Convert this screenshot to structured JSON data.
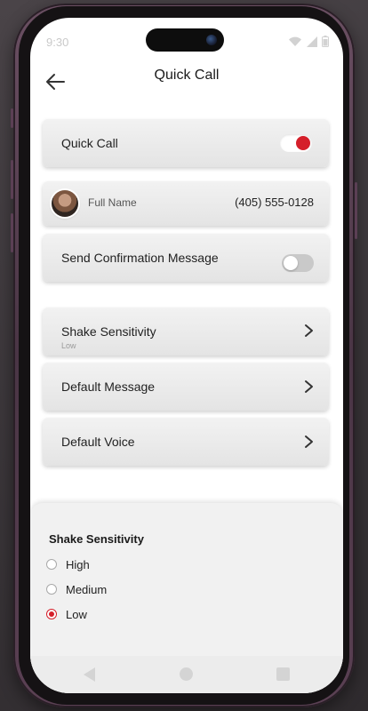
{
  "status_bar": {
    "time": "9:30"
  },
  "header": {
    "title": "Quick Call"
  },
  "quick_call": {
    "label": "Quick Call",
    "enabled": true
  },
  "contact": {
    "name": "Full Name",
    "phone": "(405) 555-0128"
  },
  "confirmation": {
    "label": "Send Confirmation Message",
    "enabled": false
  },
  "menu": {
    "shake_sensitivity": {
      "label": "Shake Sensitivity",
      "value": "Low"
    },
    "default_message": {
      "label": "Default Message"
    },
    "default_voice": {
      "label": "Default Voice"
    }
  },
  "sheet": {
    "title": "Shake Sensitivity",
    "options": [
      {
        "label": "High",
        "selected": false
      },
      {
        "label": "Medium",
        "selected": false
      },
      {
        "label": "Low",
        "selected": true
      }
    ]
  },
  "colors": {
    "accent": "#d51f2a"
  }
}
